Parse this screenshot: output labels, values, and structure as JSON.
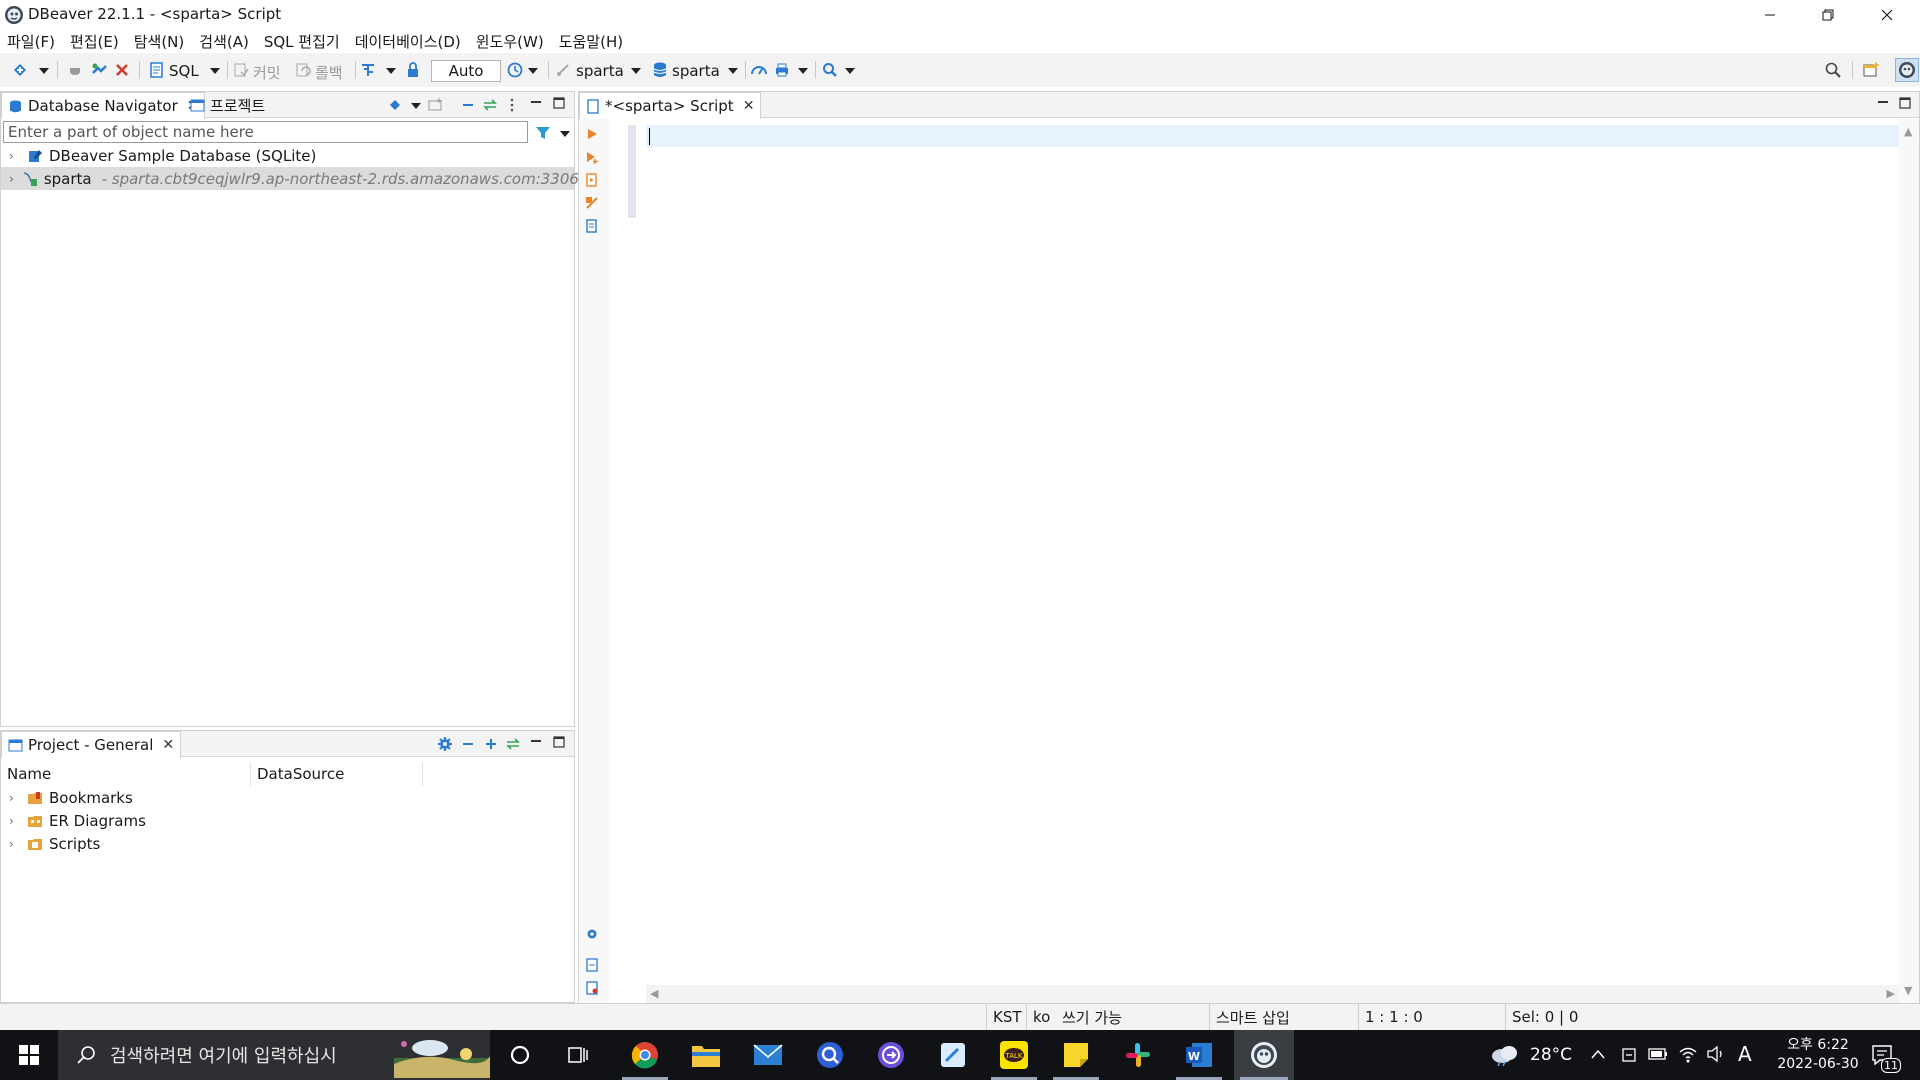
{
  "window": {
    "title": "DBeaver 22.1.1 - <sparta> Script"
  },
  "menu": [
    "파일(F)",
    "편집(E)",
    "탐색(N)",
    "검색(A)",
    "SQL 편집기",
    "데이터베이스(D)",
    "윈도우(W)",
    "도움말(H)"
  ],
  "toolbar": {
    "sql_label": "SQL",
    "commit_label": "커밋",
    "rollback_label": "롤백",
    "tx_mode": "Auto",
    "active_connection": "sparta",
    "active_schema": "sparta"
  },
  "navigator": {
    "tab_label": "Database Navigator",
    "projects_tab_label": "프로젝트",
    "filter_placeholder": "Enter a part of object name here",
    "items": [
      {
        "label": "DBeaver Sample Database (SQLite)",
        "detail": ""
      },
      {
        "label": "sparta",
        "detail": "- sparta.cbt9ceqjwlr9.ap-northeast-2.rds.amazonaws.com:3306"
      }
    ]
  },
  "project": {
    "tab_label": "Project - General",
    "columns": [
      "Name",
      "DataSource"
    ],
    "items": [
      "Bookmarks",
      "ER Diagrams",
      "Scripts"
    ]
  },
  "editor": {
    "tab_label": "*<sparta> Script"
  },
  "status": {
    "timezone": "KST",
    "locale": "ko",
    "write_mode": "쓰기 가능",
    "insert_mode": "스마트 삽입",
    "position": "1 : 1 : 0",
    "selection": "Sel: 0 | 0"
  },
  "taskbar": {
    "search_placeholder": "검색하려면 여기에 입력하십시",
    "weather": "28°C",
    "ime": "A",
    "time_line1": "오후 6:22",
    "time_line2": "2022-06-30",
    "notifications": "11"
  },
  "colors": {
    "accent": "#1e6fc7",
    "selection": "#dcdcdc",
    "taskbar": "#101216"
  }
}
